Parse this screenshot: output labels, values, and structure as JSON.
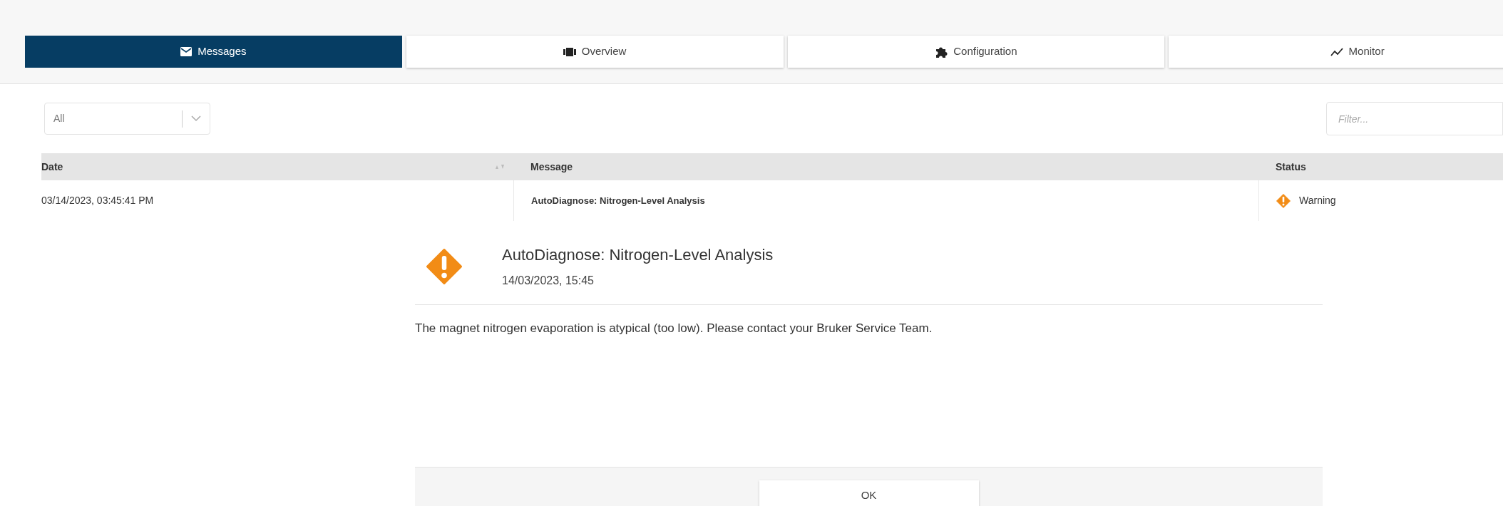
{
  "tabs": [
    {
      "label": "Messages",
      "kind": "envelope",
      "selected": true
    },
    {
      "label": "Overview",
      "kind": "film",
      "selected": false
    },
    {
      "label": "Configuration",
      "kind": "puzzle",
      "selected": false
    },
    {
      "label": "Monitor",
      "kind": "chart",
      "selected": false
    }
  ],
  "type_filter": {
    "value": "All"
  },
  "filter": {
    "placeholder": "Filter..."
  },
  "table": {
    "columns": [
      "Date",
      "Message",
      "Status"
    ],
    "rows": [
      {
        "date": "03/14/2023, 03:45:41 PM",
        "message": "AutoDiagnose: Nitrogen-Level Analysis",
        "status": "Warning",
        "kind": "warning"
      }
    ]
  },
  "dialog": {
    "kind": "warning",
    "title": "AutoDiagnose: Nitrogen-Level Analysis",
    "date": "14/03/2023, 15:45",
    "body": "The magnet nitrogen evaporation is atypical (too low). Please contact your Bruker Service Team.",
    "button": "OK"
  }
}
